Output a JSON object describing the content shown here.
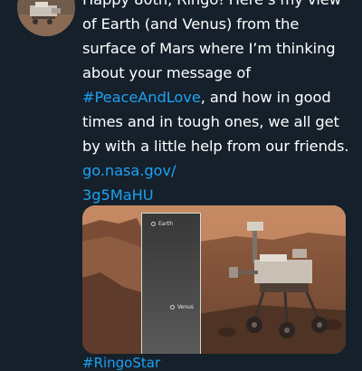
{
  "tweet": {
    "text_intro": "Happy 80th, Ringo! Here’s my view of Earth (and Venus) from the surface of Mars where I’m thinking about your message of ",
    "hashtag": "#PeaceAndLove",
    "text_middle": ", and how in good times and in tough ones, we all get by with a little help from our friends. ",
    "link_line1": "go.nasa.gov/",
    "link_line2": "3g5MaHU",
    "below_media": "#RingoStar"
  },
  "media": {
    "earth_label": "Earth",
    "venus_label": "Venus"
  },
  "colors": {
    "background": "#15202b",
    "text": "#ffffff",
    "link": "#1da1f2",
    "mars_surface": "#b07552"
  },
  "icons": {
    "avatar": "rover-avatar"
  }
}
